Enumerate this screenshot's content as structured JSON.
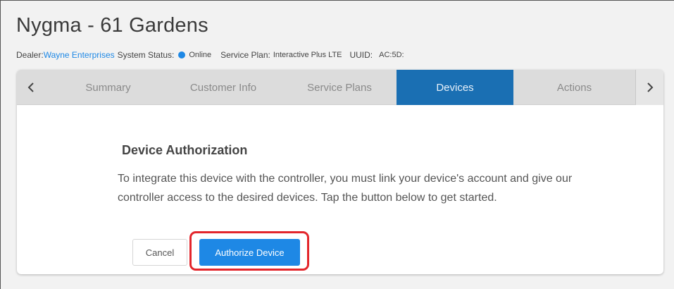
{
  "customer": {
    "title": "Nygma - 61 Gardens"
  },
  "meta": {
    "dealer_label": "Dealer:",
    "dealer_value": "Wayne Enterprises",
    "system_status_label": "System Status:",
    "system_status_value": "Online",
    "service_plan_label": "Service Plan:",
    "service_plan_value": "Interactive Plus LTE",
    "uuid_label": "UUID:",
    "uuid_value": "AC:5D:"
  },
  "tabs": [
    {
      "label": "Summary",
      "active": false
    },
    {
      "label": "Customer Info",
      "active": false
    },
    {
      "label": "Service Plans",
      "active": false
    },
    {
      "label": "Devices",
      "active": true
    },
    {
      "label": "Actions",
      "active": false
    }
  ],
  "icons": {
    "prev": "chevron-left-icon",
    "next": "chevron-right-icon",
    "status": "status-dot-icon"
  },
  "authorization": {
    "heading": "Device Authorization",
    "description": "To integrate this device with the controller, you must link your device's account and give our controller access to the desired devices. Tap the button below to get started.",
    "cancel_label": "Cancel",
    "authorize_label": "Authorize Device"
  },
  "colors": {
    "accent": "#1e88e5",
    "active_tab": "#1a6fb3",
    "highlight": "#e3262c"
  }
}
